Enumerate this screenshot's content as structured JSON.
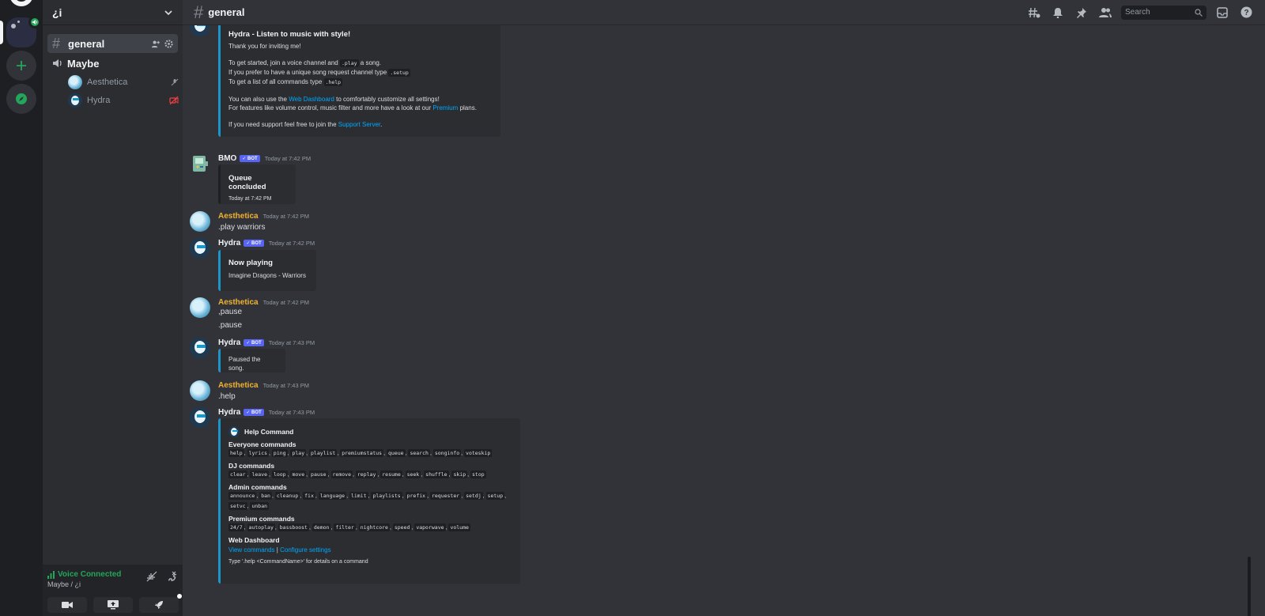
{
  "server_rail": {
    "icons": [
      "server-logo-icon",
      "active-server-icon",
      "add-server-icon",
      "explore-icon"
    ]
  },
  "sidebar": {
    "guild_name": "¿i",
    "text_channel": "general",
    "voice_channel": "Maybe",
    "voice_users": [
      {
        "name": "Aesthetica"
      },
      {
        "name": "Hydra"
      }
    ]
  },
  "voice_panel": {
    "status": "Voice Connected",
    "location": "Maybe / ¿i"
  },
  "header": {
    "channel": "general",
    "search_placeholder": "Search"
  },
  "colors": {
    "accent": "#5865f2",
    "embed_border": "#1a96c8",
    "aesthetica": "#f0b232",
    "link": "#00a8fc",
    "voice_green": "#23a55a"
  },
  "messages": {
    "welcome": {
      "title": "Hydra - Listen to music with style!",
      "thanks": "Thank you for inviting me!",
      "l1a": "To get started, join a voice channel and ",
      "l1code": ".play",
      "l1b": " a song.",
      "l2a": "If you prefer to have a unique song request channel type ",
      "l2code": ".setup",
      "l3a": "To get a list of all commands type ",
      "l3code": ".help",
      "l4a": "You can also use the ",
      "l4link": "Web Dashboard",
      "l4b": " to comfortably customize all settings!",
      "l5a": "For features like volume control, music filter and more have a look at our ",
      "l5link": "Premium",
      "l5b": " plans.",
      "l6a": "If you need support feel free to join the ",
      "l6link": "Support Server",
      "l6b": "."
    },
    "bmo": {
      "author": "BMO",
      "bot": "✓ BOT",
      "time": "Today at 7:42 PM",
      "embed_title": "Queue concluded",
      "embed_time": "Today at 7:42 PM"
    },
    "aes1": {
      "author": "Aesthetica",
      "time": "Today at 7:42 PM",
      "text": ".play warriors"
    },
    "hydra1": {
      "author": "Hydra",
      "bot": "✓ BOT",
      "time": "Today at 7:42 PM",
      "embed_title": "Now playing",
      "embed_text": "Imagine Dragons - Warriors"
    },
    "aes2": {
      "author": "Aesthetica",
      "time": "Today at 7:42 PM",
      "text1": ",pause",
      "text2": ".pause"
    },
    "hydra2": {
      "author": "Hydra",
      "bot": "✓ BOT",
      "time": "Today at 7:43 PM",
      "embed_text": "Paused the song."
    },
    "aes3": {
      "author": "Aesthetica",
      "time": "Today at 7:43 PM",
      "text": ".help"
    },
    "hydra3": {
      "author": "Hydra",
      "bot": "✓ BOT",
      "time": "Today at 7:43 PM",
      "embed_title": "Help Command",
      "sections": [
        {
          "title": "Everyone commands",
          "cmds": [
            "help",
            "lyrics",
            "ping",
            "play",
            "playlist",
            "premiumstatus",
            "queue",
            "search",
            "songinfo",
            "voteskip"
          ]
        },
        {
          "title": "DJ commands",
          "cmds": [
            "clear",
            "leave",
            "loop",
            "move",
            "pause",
            "remove",
            "replay",
            "resume",
            "seek",
            "shuffle",
            "skip",
            "stop"
          ]
        },
        {
          "title": "Admin commands",
          "cmds": [
            "announce",
            "ban",
            "cleanup",
            "fix",
            "language",
            "limit",
            "playlists",
            "prefix",
            "requester",
            "setdj",
            "setup",
            "setvc",
            "unban"
          ]
        },
        {
          "title": "Premium commands",
          "cmds": [
            "24/7",
            "autoplay",
            "bassboost",
            "demon",
            "filter",
            "nightcore",
            "speed",
            "vaporwave",
            "volume"
          ]
        }
      ],
      "dashboard_title": "Web Dashboard",
      "dash_link1": "View commands",
      "dash_sep": "|",
      "dash_link2": "Configure settings",
      "footer": "Type '.help <CommandName>' for details on a command"
    }
  }
}
